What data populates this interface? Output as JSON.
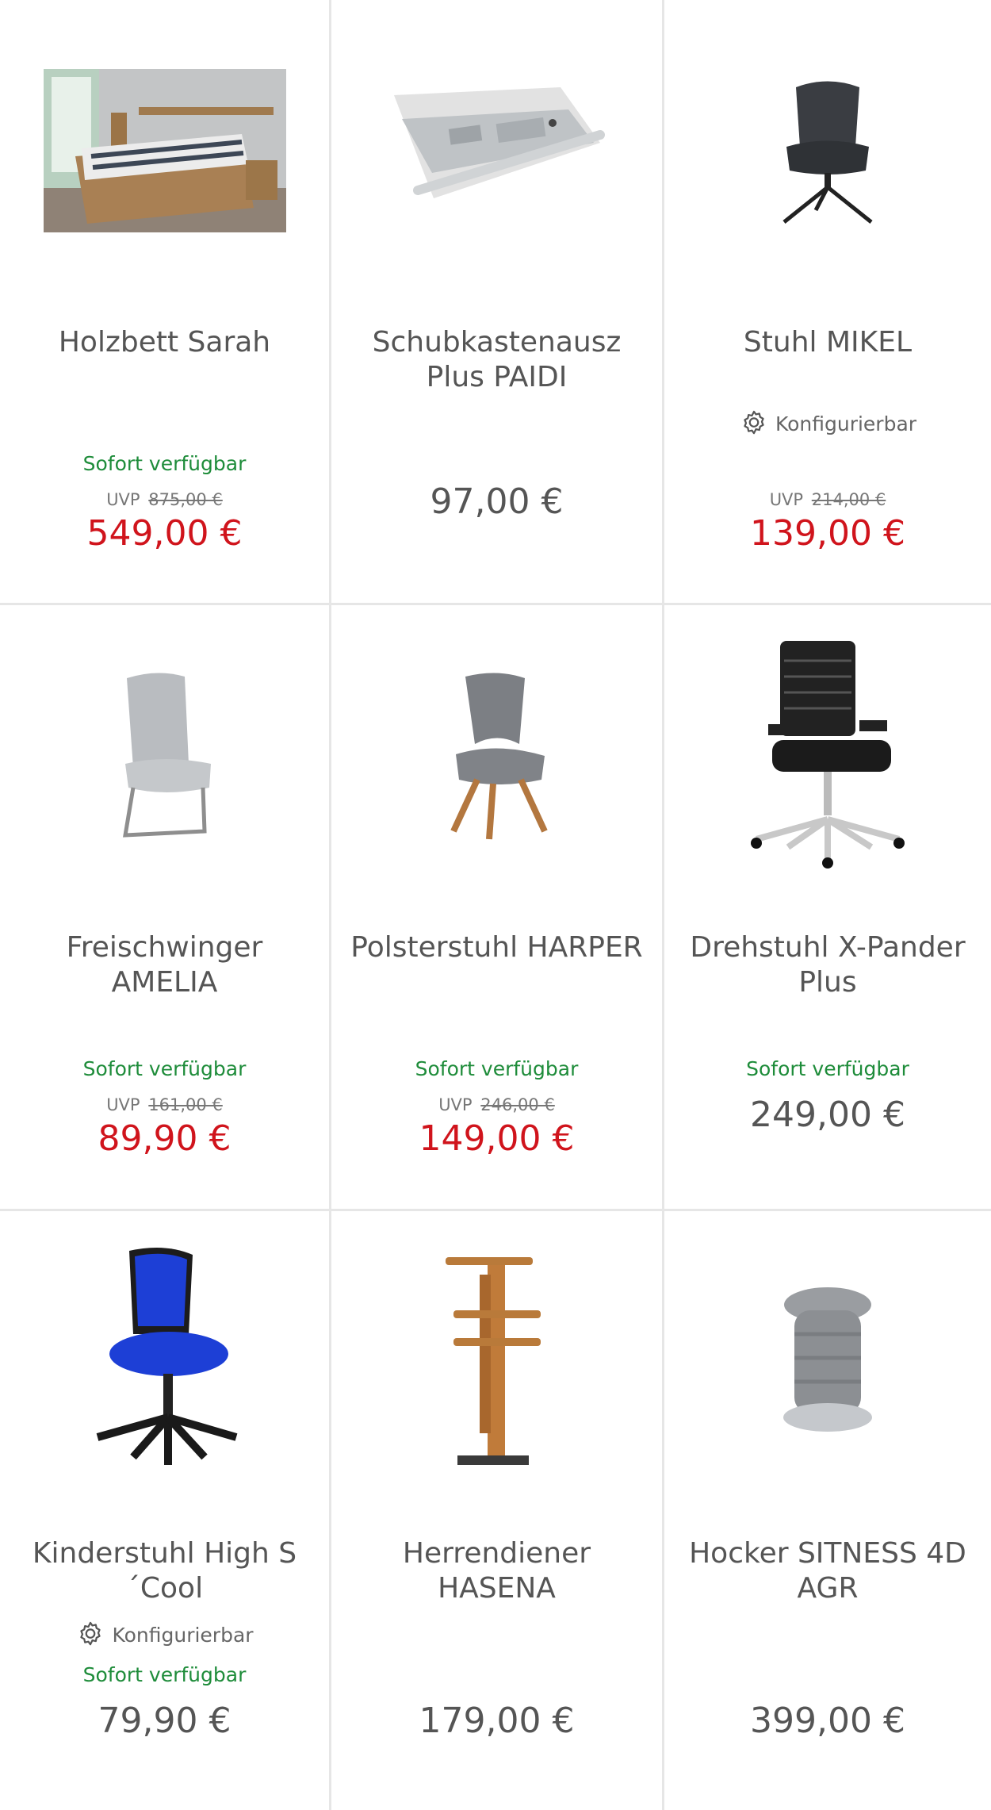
{
  "products": [
    {
      "title": "Holzbett Sarah",
      "available": "Sofort verfügbar",
      "uvp_label": "UVP",
      "uvp": "875,00 €",
      "price": "549,00 €",
      "configurable": ""
    },
    {
      "title": "Schubkastenausz Plus PAIDI",
      "available": "",
      "uvp_label": "",
      "uvp": "",
      "price": "97,00 €",
      "configurable": ""
    },
    {
      "title": "Stuhl MIKEL",
      "available": "",
      "uvp_label": "UVP",
      "uvp": "214,00 €",
      "price": "139,00 €",
      "configurable": "Konfigurierbar"
    },
    {
      "title": "Freischwinger AMELIA",
      "available": "Sofort verfügbar",
      "uvp_label": "UVP",
      "uvp": "161,00 €",
      "price": "89,90 €",
      "configurable": ""
    },
    {
      "title": "Polsterstuhl HARPER",
      "available": "Sofort verfügbar",
      "uvp_label": "UVP",
      "uvp": "246,00 €",
      "price": "149,00 €",
      "configurable": ""
    },
    {
      "title": "Drehstuhl X-Pander Plus",
      "available": "Sofort verfügbar",
      "uvp_label": "",
      "uvp": "",
      "price": "249,00 €",
      "configurable": ""
    },
    {
      "title": "Kinderstuhl High S´Cool",
      "available": "Sofort verfügbar",
      "uvp_label": "",
      "uvp": "",
      "price": "79,90 €",
      "configurable": "Konfigurierbar"
    },
    {
      "title": "Herrendiener HASENA",
      "available": "",
      "uvp_label": "",
      "uvp": "",
      "price": "179,00 €",
      "configurable": ""
    },
    {
      "title": "Hocker SITNESS 4D AGR",
      "available": "",
      "uvp_label": "",
      "uvp": "",
      "price": "399,00 €",
      "configurable": ""
    }
  ],
  "colors": {
    "available": "#1e8c3a",
    "sale_price": "#d0141c",
    "regular_price": "#555555",
    "divider": "#e6e6e6"
  },
  "icons": {
    "configurable": "gear-icon"
  }
}
